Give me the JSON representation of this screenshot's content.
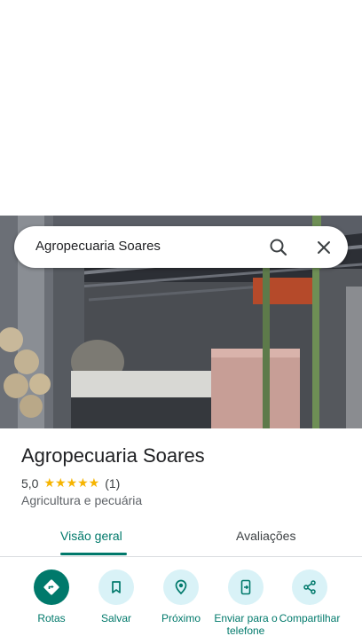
{
  "search": {
    "query": "Agropecuaria Soares"
  },
  "place": {
    "name": "Agropecuaria Soares",
    "rating": "5,0",
    "stars": "★★★★★",
    "review_count": "(1)",
    "category": "Agricultura e pecuária"
  },
  "tabs": [
    {
      "label": "Visão geral",
      "active": true
    },
    {
      "label": "Avaliações",
      "active": false
    }
  ],
  "actions": [
    {
      "label": "Rotas",
      "icon": "directions-icon"
    },
    {
      "label": "Salvar",
      "icon": "bookmark-icon"
    },
    {
      "label": "Próximo",
      "icon": "nearby-icon"
    },
    {
      "label": "Enviar para o telefone",
      "icon": "send-to-phone-icon"
    },
    {
      "label": "Compartilhar",
      "icon": "share-icon"
    }
  ],
  "colors": {
    "accent": "#00796b",
    "star": "#f6b400",
    "action_bg": "#d9f2f7"
  }
}
